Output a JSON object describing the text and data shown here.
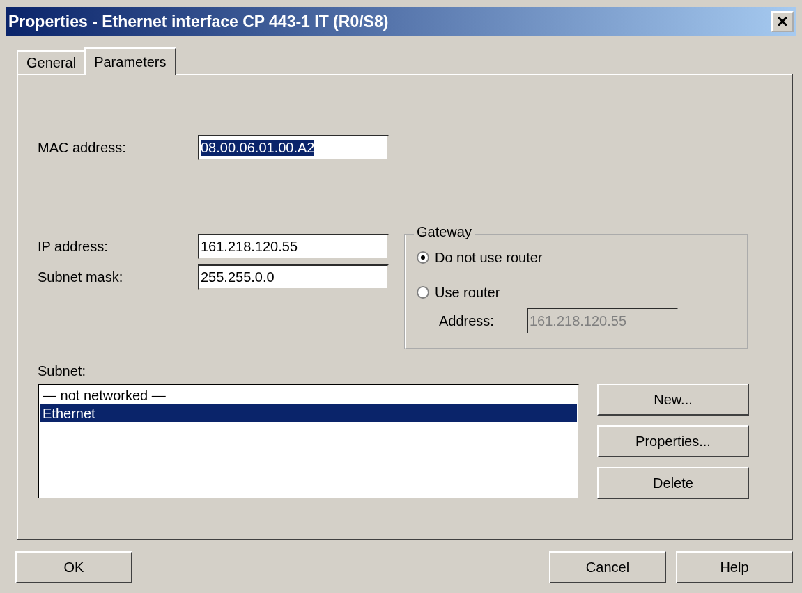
{
  "window": {
    "title": "Properties - Ethernet interface  CP 443-1 IT (R0/S8)",
    "close": "×"
  },
  "tabs": [
    {
      "label": "General",
      "selected": false
    },
    {
      "label": "Parameters",
      "selected": true
    }
  ],
  "mac": {
    "label": "MAC address:",
    "value": "08.00.06.01.00.A2",
    "text_selected": true
  },
  "ip": {
    "label": "IP address:",
    "value": "161.218.120.55"
  },
  "subnet_mask": {
    "label": "Subnet mask:",
    "value": "255.255.0.0"
  },
  "gateway": {
    "title": "Gateway",
    "options": [
      {
        "label": "Do not use router",
        "selected": true
      },
      {
        "label": "Use router",
        "selected": false
      }
    ],
    "address": {
      "label": "Address:",
      "value": "161.218.120.55",
      "disabled": true
    }
  },
  "subnet": {
    "label": "Subnet:",
    "items": [
      {
        "label": "— not networked —",
        "selected": false
      },
      {
        "label": "Ethernet",
        "selected": true
      }
    ]
  },
  "subnet_buttons": [
    "New...",
    "Properties...",
    "Delete"
  ],
  "buttons": [
    {
      "label": "OK"
    },
    {
      "label": "Cancel"
    },
    {
      "label": "Help"
    }
  ]
}
